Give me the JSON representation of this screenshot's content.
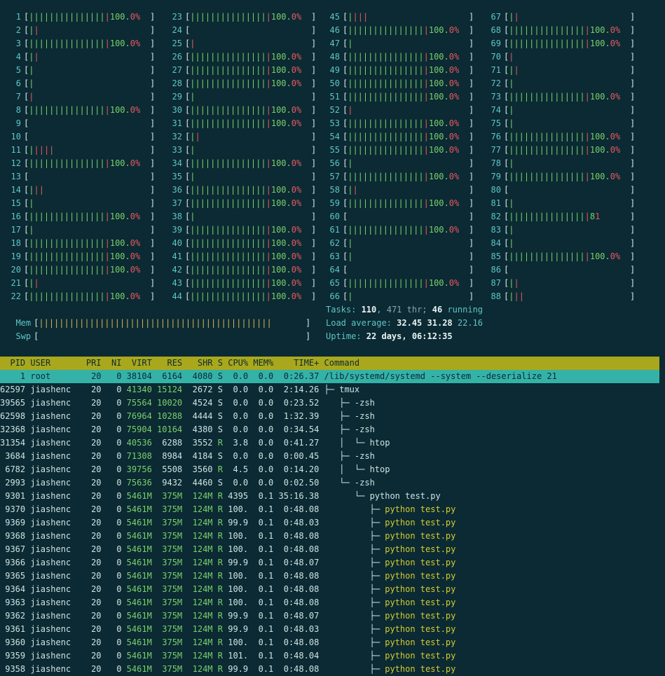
{
  "cpus": [
    {
      "n": "1",
      "bar": "||||||||||||||||",
      "pct": "100.0%"
    },
    {
      "n": "2",
      "bar": "||",
      "pct": ""
    },
    {
      "n": "3",
      "bar": "||||||||||||||||",
      "pct": "100.0%"
    },
    {
      "n": "4",
      "bar": "||",
      "pct": ""
    },
    {
      "n": "5",
      "bar": "|",
      "pct": ""
    },
    {
      "n": "6",
      "bar": "|",
      "pct": ""
    },
    {
      "n": "7",
      "bar": "|",
      "pct": ""
    },
    {
      "n": "8",
      "bar": "||||||||||||||||",
      "pct": "100.0%"
    },
    {
      "n": "9",
      "bar": "",
      "pct": ""
    },
    {
      "n": "10",
      "bar": "",
      "pct": ""
    },
    {
      "n": "11",
      "bar": "|||||",
      "pct": ""
    },
    {
      "n": "12",
      "bar": "||||||||||||||||",
      "pct": "100.0%"
    },
    {
      "n": "13",
      "bar": "",
      "pct": ""
    },
    {
      "n": "14",
      "bar": "|||",
      "pct": ""
    },
    {
      "n": "15",
      "bar": "|",
      "pct": ""
    },
    {
      "n": "16",
      "bar": "||||||||||||||||",
      "pct": "100.0%"
    },
    {
      "n": "17",
      "bar": "|",
      "pct": ""
    },
    {
      "n": "18",
      "bar": "||||||||||||||||",
      "pct": "100.0%"
    },
    {
      "n": "19",
      "bar": "||||||||||||||||",
      "pct": "100.0%"
    },
    {
      "n": "20",
      "bar": "||||||||||||||||",
      "pct": "100.0%"
    },
    {
      "n": "21",
      "bar": "||",
      "pct": ""
    },
    {
      "n": "22",
      "bar": "||||||||||||||||",
      "pct": "100.0%"
    },
    {
      "n": "23",
      "bar": "||||||||||||||||",
      "pct": "100.0%"
    },
    {
      "n": "24",
      "bar": "",
      "pct": ""
    },
    {
      "n": "25",
      "bar": "|",
      "pct": ""
    },
    {
      "n": "26",
      "bar": "||||||||||||||||",
      "pct": "100.0%"
    },
    {
      "n": "27",
      "bar": "||||||||||||||||",
      "pct": "100.0%"
    },
    {
      "n": "28",
      "bar": "||||||||||||||||",
      "pct": "100.0%"
    },
    {
      "n": "29",
      "bar": "|",
      "pct": ""
    },
    {
      "n": "30",
      "bar": "||||||||||||||||",
      "pct": "100.0%"
    },
    {
      "n": "31",
      "bar": "||||||||||||||||",
      "pct": "100.0%"
    },
    {
      "n": "32",
      "bar": "||",
      "pct": ""
    },
    {
      "n": "33",
      "bar": "|",
      "pct": ""
    },
    {
      "n": "34",
      "bar": "||||||||||||||||",
      "pct": "100.0%"
    },
    {
      "n": "35",
      "bar": "|",
      "pct": ""
    },
    {
      "n": "36",
      "bar": "||||||||||||||||",
      "pct": "100.0%"
    },
    {
      "n": "37",
      "bar": "||||||||||||||||",
      "pct": "100.0%"
    },
    {
      "n": "38",
      "bar": "|",
      "pct": ""
    },
    {
      "n": "39",
      "bar": "||||||||||||||||",
      "pct": "100.0%"
    },
    {
      "n": "40",
      "bar": "||||||||||||||||",
      "pct": "100.0%"
    },
    {
      "n": "41",
      "bar": "||||||||||||||||",
      "pct": "100.0%"
    },
    {
      "n": "42",
      "bar": "||||||||||||||||",
      "pct": "100.0%"
    },
    {
      "n": "43",
      "bar": "||||||||||||||||",
      "pct": "100.0%"
    },
    {
      "n": "44",
      "bar": "||||||||||||||||",
      "pct": "100.0%"
    },
    {
      "n": "45",
      "bar": "||||",
      "pct": ""
    },
    {
      "n": "46",
      "bar": "||||||||||||||||",
      "pct": "100.0%"
    },
    {
      "n": "47",
      "bar": "|",
      "pct": ""
    },
    {
      "n": "48",
      "bar": "||||||||||||||||",
      "pct": "100.0%"
    },
    {
      "n": "49",
      "bar": "||||||||||||||||",
      "pct": "100.0%"
    },
    {
      "n": "50",
      "bar": "||||||||||||||||",
      "pct": "100.0%"
    },
    {
      "n": "51",
      "bar": "||||||||||||||||",
      "pct": "100.0%"
    },
    {
      "n": "52",
      "bar": "|",
      "pct": ""
    },
    {
      "n": "53",
      "bar": "||||||||||||||||",
      "pct": "100.0%"
    },
    {
      "n": "54",
      "bar": "||||||||||||||||",
      "pct": "100.0%"
    },
    {
      "n": "55",
      "bar": "||||||||||||||||",
      "pct": "100.0%"
    },
    {
      "n": "56",
      "bar": "|",
      "pct": ""
    },
    {
      "n": "57",
      "bar": "||||||||||||||||",
      "pct": "100.0%"
    },
    {
      "n": "58",
      "bar": "||",
      "pct": ""
    },
    {
      "n": "59",
      "bar": "||||||||||||||||",
      "pct": "100.0%"
    },
    {
      "n": "60",
      "bar": "",
      "pct": ""
    },
    {
      "n": "61",
      "bar": "||||||||||||||||",
      "pct": "100.0%"
    },
    {
      "n": "62",
      "bar": "|",
      "pct": ""
    },
    {
      "n": "63",
      "bar": "|",
      "pct": ""
    },
    {
      "n": "64",
      "bar": "",
      "pct": ""
    },
    {
      "n": "65",
      "bar": "||||||||||||||||",
      "pct": "100.0%"
    },
    {
      "n": "66",
      "bar": "|",
      "pct": ""
    },
    {
      "n": "67",
      "bar": "||",
      "pct": ""
    },
    {
      "n": "68",
      "bar": "||||||||||||||||",
      "pct": "100.0%"
    },
    {
      "n": "69",
      "bar": "||||||||||||||||",
      "pct": "100.0%"
    },
    {
      "n": "70",
      "bar": "|",
      "pct": ""
    },
    {
      "n": "71",
      "bar": "||",
      "pct": ""
    },
    {
      "n": "72",
      "bar": "|",
      "pct": ""
    },
    {
      "n": "73",
      "bar": "||||||||||||||||",
      "pct": "100.0%"
    },
    {
      "n": "74",
      "bar": "|",
      "pct": ""
    },
    {
      "n": "75",
      "bar": "|",
      "pct": ""
    },
    {
      "n": "76",
      "bar": "||||||||||||||||",
      "pct": "100.0%"
    },
    {
      "n": "77",
      "bar": "||||||||||||||||",
      "pct": "100.0%"
    },
    {
      "n": "78",
      "bar": "|",
      "pct": ""
    },
    {
      "n": "79",
      "bar": "||||||||||||||||",
      "pct": "100.0%"
    },
    {
      "n": "80",
      "bar": "",
      "pct": ""
    },
    {
      "n": "81",
      "bar": "|",
      "pct": ""
    },
    {
      "n": "82",
      "bar": "||||||||||||||||",
      "pct": "81"
    },
    {
      "n": "83",
      "bar": "|",
      "pct": ""
    },
    {
      "n": "84",
      "bar": "|",
      "pct": ""
    },
    {
      "n": "85",
      "bar": "||||||||||||||||",
      "pct": "100.0%"
    },
    {
      "n": "86",
      "bar": "",
      "pct": ""
    },
    {
      "n": "87",
      "bar": "||",
      "pct": ""
    },
    {
      "n": "88",
      "bar": "|||",
      "pct": ""
    }
  ],
  "mem": {
    "label": "Mem",
    "bar": "||||||||||||||||||||||||||||||||||||||||||||||"
  },
  "swp": {
    "label": "Swp",
    "bar": ""
  },
  "tasks": {
    "label": "Tasks: ",
    "count": "110",
    "thr": "471",
    "thr_label": " thr; ",
    "running": "46",
    "running_label": " running"
  },
  "load": {
    "label": "Load average: ",
    "l1": "32.45",
    "l5": "31.28",
    "l15": "22.16"
  },
  "uptime": {
    "label": "Uptime: ",
    "value": "22 days, 06:12:35"
  },
  "columns": [
    "PID",
    "USER",
    "PRI",
    "NI",
    "VIRT",
    "RES",
    "SHR",
    "S",
    "CPU%",
    "MEM%",
    "TIME+",
    "Command"
  ],
  "processes": [
    {
      "pid": "1",
      "user": "root",
      "pri": "20",
      "ni": "0",
      "virt": "38104",
      "res": "6164",
      "shr": "4080",
      "s": "S",
      "cpu": "0.0",
      "mem": "0.0",
      "time": "0:26.37",
      "tree": "",
      "cmd": "/lib/systemd/systemd --system --deserialize 21",
      "selected": true
    },
    {
      "pid": "62597",
      "user": "jiashenc",
      "pri": "20",
      "ni": "0",
      "virt": "41340",
      "res": "15124",
      "shr": "2672",
      "s": "S",
      "cpu": "0.0",
      "mem": "0.0",
      "time": "2:14.26",
      "tree": "├─ ",
      "cmd": "tmux"
    },
    {
      "pid": "39565",
      "user": "jiashenc",
      "pri": "20",
      "ni": "0",
      "virt": "75564",
      "res": "10020",
      "shr": "4524",
      "s": "S",
      "cpu": "0.0",
      "mem": "0.0",
      "time": "0:23.52",
      "tree": "   ├─ ",
      "cmd": "-zsh"
    },
    {
      "pid": "62598",
      "user": "jiashenc",
      "pri": "20",
      "ni": "0",
      "virt": "76964",
      "res": "10288",
      "shr": "4444",
      "s": "S",
      "cpu": "0.0",
      "mem": "0.0",
      "time": "1:32.39",
      "tree": "   ├─ ",
      "cmd": "-zsh"
    },
    {
      "pid": "32368",
      "user": "jiashenc",
      "pri": "20",
      "ni": "0",
      "virt": "75904",
      "res": "10164",
      "shr": "4380",
      "s": "S",
      "cpu": "0.0",
      "mem": "0.0",
      "time": "0:34.54",
      "tree": "   ├─ ",
      "cmd": "-zsh"
    },
    {
      "pid": "31354",
      "user": "jiashenc",
      "pri": "20",
      "ni": "0",
      "virt": "40536",
      "res": "6288",
      "shr": "3552",
      "s": "R",
      "cpu": "3.8",
      "mem": "0.0",
      "time": "0:41.27",
      "tree": "   │  └─ ",
      "cmd": "htop"
    },
    {
      "pid": "3684",
      "user": "jiashenc",
      "pri": "20",
      "ni": "0",
      "virt": "71308",
      "res": "8984",
      "shr": "4184",
      "s": "S",
      "cpu": "0.0",
      "mem": "0.0",
      "time": "0:00.45",
      "tree": "   ├─ ",
      "cmd": "-zsh"
    },
    {
      "pid": "6782",
      "user": "jiashenc",
      "pri": "20",
      "ni": "0",
      "virt": "39756",
      "res": "5508",
      "shr": "3560",
      "s": "R",
      "cpu": "4.5",
      "mem": "0.0",
      "time": "0:14.20",
      "tree": "   │  └─ ",
      "cmd": "htop"
    },
    {
      "pid": "2993",
      "user": "jiashenc",
      "pri": "20",
      "ni": "0",
      "virt": "75636",
      "res": "9432",
      "shr": "4460",
      "s": "S",
      "cpu": "0.0",
      "mem": "0.0",
      "time": "0:02.50",
      "tree": "   └─ ",
      "cmd": "-zsh"
    },
    {
      "pid": "9301",
      "user": "jiashenc",
      "pri": "20",
      "ni": "0",
      "virt": "5461M",
      "res": "375M",
      "shr": "124M",
      "s": "R",
      "cpu": "4395",
      "mem": "0.1",
      "time": "35:16.38",
      "tree": "      └─ ",
      "cmd": "python test.py"
    },
    {
      "pid": "9370",
      "user": "jiashenc",
      "pri": "20",
      "ni": "0",
      "virt": "5461M",
      "res": "375M",
      "shr": "124M",
      "s": "R",
      "cpu": "100.",
      "mem": "0.1",
      "time": "0:48.08",
      "tree": "         ├─ ",
      "cmd": "python test.py",
      "thread": true
    },
    {
      "pid": "9369",
      "user": "jiashenc",
      "pri": "20",
      "ni": "0",
      "virt": "5461M",
      "res": "375M",
      "shr": "124M",
      "s": "R",
      "cpu": "99.9",
      "mem": "0.1",
      "time": "0:48.03",
      "tree": "         ├─ ",
      "cmd": "python test.py",
      "thread": true
    },
    {
      "pid": "9368",
      "user": "jiashenc",
      "pri": "20",
      "ni": "0",
      "virt": "5461M",
      "res": "375M",
      "shr": "124M",
      "s": "R",
      "cpu": "100.",
      "mem": "0.1",
      "time": "0:48.08",
      "tree": "         ├─ ",
      "cmd": "python test.py",
      "thread": true
    },
    {
      "pid": "9367",
      "user": "jiashenc",
      "pri": "20",
      "ni": "0",
      "virt": "5461M",
      "res": "375M",
      "shr": "124M",
      "s": "R",
      "cpu": "100.",
      "mem": "0.1",
      "time": "0:48.08",
      "tree": "         ├─ ",
      "cmd": "python test.py",
      "thread": true
    },
    {
      "pid": "9366",
      "user": "jiashenc",
      "pri": "20",
      "ni": "0",
      "virt": "5461M",
      "res": "375M",
      "shr": "124M",
      "s": "R",
      "cpu": "99.9",
      "mem": "0.1",
      "time": "0:48.07",
      "tree": "         ├─ ",
      "cmd": "python test.py",
      "thread": true
    },
    {
      "pid": "9365",
      "user": "jiashenc",
      "pri": "20",
      "ni": "0",
      "virt": "5461M",
      "res": "375M",
      "shr": "124M",
      "s": "R",
      "cpu": "100.",
      "mem": "0.1",
      "time": "0:48.08",
      "tree": "         ├─ ",
      "cmd": "python test.py",
      "thread": true
    },
    {
      "pid": "9364",
      "user": "jiashenc",
      "pri": "20",
      "ni": "0",
      "virt": "5461M",
      "res": "375M",
      "shr": "124M",
      "s": "R",
      "cpu": "100.",
      "mem": "0.1",
      "time": "0:48.08",
      "tree": "         ├─ ",
      "cmd": "python test.py",
      "thread": true
    },
    {
      "pid": "9363",
      "user": "jiashenc",
      "pri": "20",
      "ni": "0",
      "virt": "5461M",
      "res": "375M",
      "shr": "124M",
      "s": "R",
      "cpu": "100.",
      "mem": "0.1",
      "time": "0:48.08",
      "tree": "         ├─ ",
      "cmd": "python test.py",
      "thread": true
    },
    {
      "pid": "9362",
      "user": "jiashenc",
      "pri": "20",
      "ni": "0",
      "virt": "5461M",
      "res": "375M",
      "shr": "124M",
      "s": "R",
      "cpu": "99.9",
      "mem": "0.1",
      "time": "0:48.07",
      "tree": "         ├─ ",
      "cmd": "python test.py",
      "thread": true
    },
    {
      "pid": "9361",
      "user": "jiashenc",
      "pri": "20",
      "ni": "0",
      "virt": "5461M",
      "res": "375M",
      "shr": "124M",
      "s": "R",
      "cpu": "99.9",
      "mem": "0.1",
      "time": "0:48.03",
      "tree": "         ├─ ",
      "cmd": "python test.py",
      "thread": true
    },
    {
      "pid": "9360",
      "user": "jiashenc",
      "pri": "20",
      "ni": "0",
      "virt": "5461M",
      "res": "375M",
      "shr": "124M",
      "s": "R",
      "cpu": "100.",
      "mem": "0.1",
      "time": "0:48.08",
      "tree": "         ├─ ",
      "cmd": "python test.py",
      "thread": true
    },
    {
      "pid": "9359",
      "user": "jiashenc",
      "pri": "20",
      "ni": "0",
      "virt": "5461M",
      "res": "375M",
      "shr": "124M",
      "s": "R",
      "cpu": "101.",
      "mem": "0.1",
      "time": "0:48.04",
      "tree": "         ├─ ",
      "cmd": "python test.py",
      "thread": true
    },
    {
      "pid": "9358",
      "user": "jiashenc",
      "pri": "20",
      "ni": "0",
      "virt": "5461M",
      "res": "375M",
      "shr": "124M",
      "s": "R",
      "cpu": "99.9",
      "mem": "0.1",
      "time": "0:48.08",
      "tree": "         ├─ ",
      "cmd": "python test.py",
      "thread": true
    }
  ],
  "colors": {
    "bg": "#0b2a33",
    "header_bg": "#a9a81c",
    "selected_bg": "#34b2a8",
    "bar_green": "#7ad06b",
    "bar_red": "#e85860",
    "mem_bar": "#d6b25a",
    "thread_cmd": "#d5cc31",
    "cyan": "#5ec6c8"
  }
}
